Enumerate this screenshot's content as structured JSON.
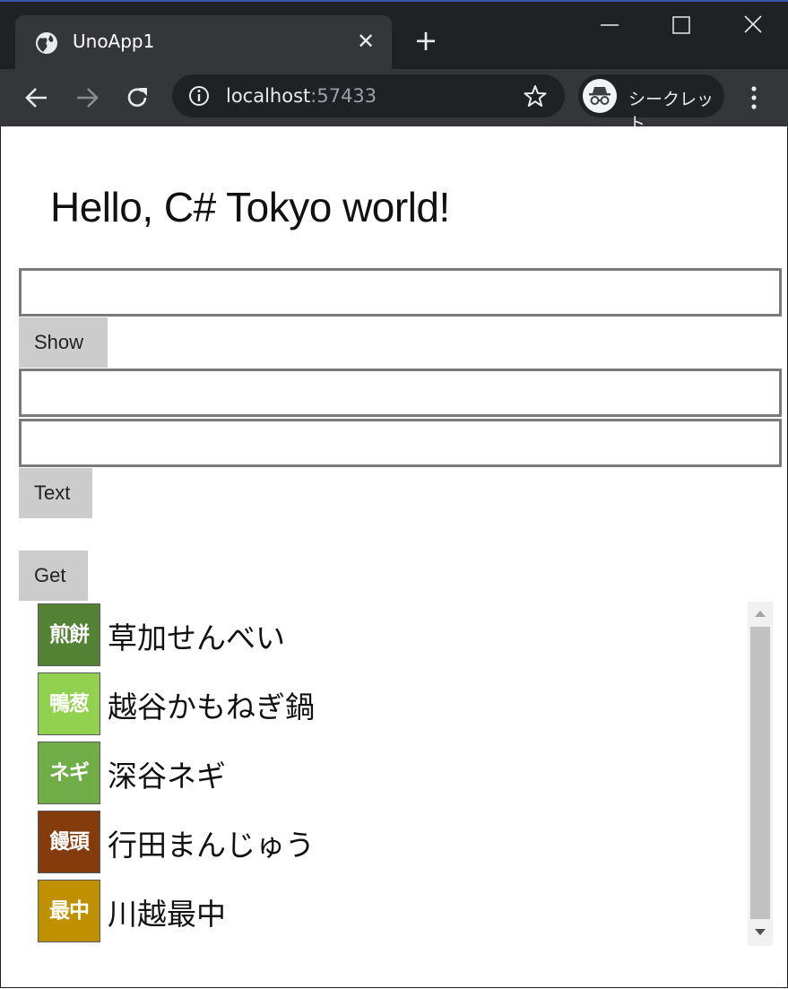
{
  "browser": {
    "tab_title": "UnoApp1",
    "tab_close_glyph": "✕",
    "new_tab_glyph": "+",
    "url_host": "localhost",
    "url_port": ":57433",
    "incognito_label": "シークレット"
  },
  "page": {
    "headline": "Hello, C# Tokyo world!",
    "input1": {
      "value": "",
      "placeholder": ""
    },
    "show_button": "Show",
    "input2": {
      "value": "",
      "placeholder": ""
    },
    "input3": {
      "value": "",
      "placeholder": ""
    },
    "text_button": "Text",
    "get_button": "Get",
    "items": [
      {
        "badge": "煎餅",
        "label": "草加せんべい",
        "color": "#548235"
      },
      {
        "badge": "鴨葱",
        "label": "越谷かもねぎ鍋",
        "color": "#92d050"
      },
      {
        "badge": "ネギ",
        "label": "深谷ネギ",
        "color": "#70ad47"
      },
      {
        "badge": "饅頭",
        "label": "行田まんじゅう",
        "color": "#843c0c"
      },
      {
        "badge": "最中",
        "label": "川越最中",
        "color": "#bf9000"
      }
    ]
  },
  "icons": {
    "tab": "globe-icon",
    "nav": [
      "back-arrow-icon",
      "forward-arrow-icon",
      "reload-icon"
    ],
    "url": [
      "info-icon",
      "star-icon"
    ],
    "profile": "incognito-icon",
    "menu": "more-vert-icon"
  }
}
